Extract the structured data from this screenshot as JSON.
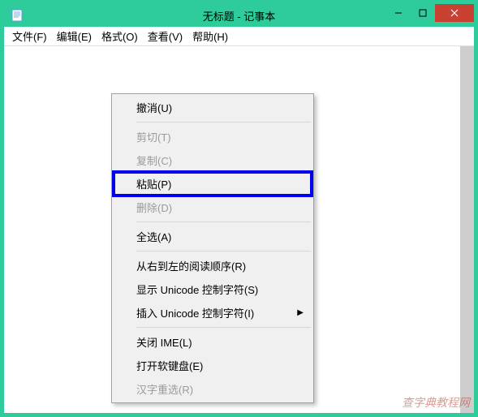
{
  "titlebar": {
    "title": "无标题 - 记事本"
  },
  "menubar": {
    "file": "文件(F)",
    "edit": "编辑(E)",
    "format": "格式(O)",
    "view": "查看(V)",
    "help": "帮助(H)"
  },
  "editor": {
    "content": ""
  },
  "contextMenu": {
    "undo": "撤消(U)",
    "cut": "剪切(T)",
    "copy": "复制(C)",
    "paste": "粘贴(P)",
    "delete": "删除(D)",
    "selectAll": "全选(A)",
    "rtlReading": "从右到左的阅读顺序(R)",
    "showUnicode": "显示 Unicode 控制字符(S)",
    "insertUnicode": "插入 Unicode 控制字符(I)",
    "closeIME": "关闭 IME(L)",
    "openSoftKeyboard": "打开软键盘(E)",
    "reconversion": "汉字重选(R)"
  },
  "watermark": "查字典教程网"
}
